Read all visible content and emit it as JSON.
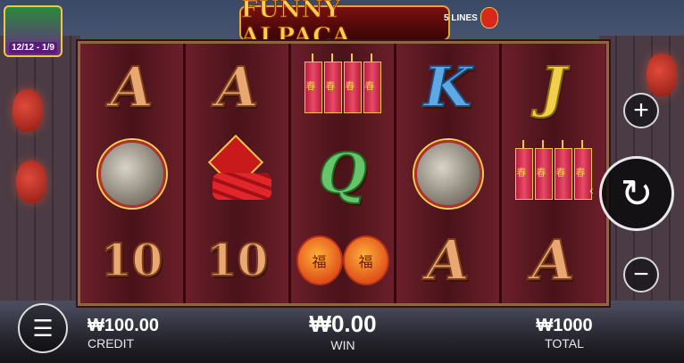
{
  "game": {
    "title": "FUNNY ALPACA",
    "lines_badge": "5 LINES"
  },
  "promo": {
    "date_range": "12/12 - 1/9"
  },
  "reels": [
    [
      "A",
      "gong",
      "10"
    ],
    [
      "A",
      "firecracker-bundle",
      "10"
    ],
    [
      "firecrackers",
      "Q",
      "lanterns"
    ],
    [
      "K",
      "gong",
      "A"
    ],
    [
      "J",
      "firecrackers",
      "A"
    ]
  ],
  "symbol_text": {
    "firecracker_char": "春",
    "lantern_char": "福",
    "knot_char": "福"
  },
  "stats": {
    "credit_value": "₩100.00",
    "credit_label": "CREDIT",
    "win_value": "₩0.00",
    "win_label": "WIN",
    "total_value": "₩1000",
    "total_label": "TOTAL"
  },
  "controls": {
    "plus_glyph": "+",
    "minus_glyph": "−",
    "spin_glyph": "↻",
    "menu_glyph": "☰",
    "arrows_glyph": "‹"
  },
  "colors": {
    "frame": "#5b1b22",
    "gold": "#f2c44a",
    "letter_orange": "#e9a872",
    "letter_blue": "#5fa8e6",
    "letter_green": "#67c46a",
    "letter_yellow": "#f2cf4a"
  }
}
